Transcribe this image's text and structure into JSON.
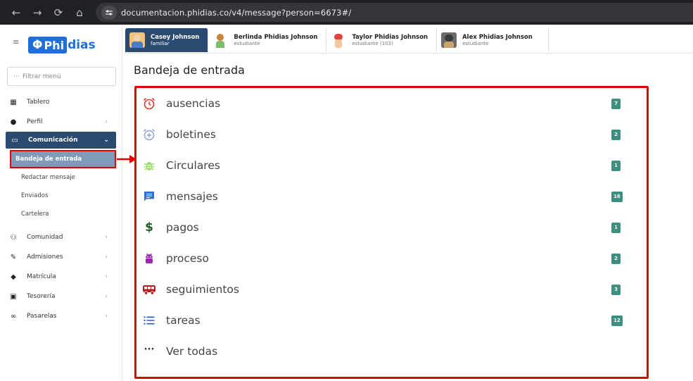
{
  "browser": {
    "url": "documentacion.phidias.co/v4/message?person=6673#/",
    "back": "←",
    "forward": "→",
    "reload": "⟳",
    "home": "⌂"
  },
  "sidebar": {
    "logo_phi": "Φ",
    "logo_text_a": "Phi",
    "logo_text_b": "dias",
    "filter_placeholder": "Filtrar menú",
    "items": [
      {
        "label": "Tablero",
        "icon": "dashboard-icon"
      },
      {
        "label": "Perfil",
        "icon": "person-icon"
      },
      {
        "label": "Comunicación",
        "icon": "message-icon"
      },
      {
        "label": "Comunidad",
        "icon": "group-icon"
      },
      {
        "label": "Admisiones",
        "icon": "admissions-icon"
      },
      {
        "label": "Matrícula",
        "icon": "graduation-cap-icon"
      },
      {
        "label": "Tesorería",
        "icon": "money-icon"
      },
      {
        "label": "Pasarelas",
        "icon": "link-icon"
      }
    ],
    "submenu": [
      {
        "label": "Bandeja de entrada"
      },
      {
        "label": "Redactar mensaje"
      },
      {
        "label": "Enviados"
      },
      {
        "label": "Cartelera"
      }
    ]
  },
  "profiles": [
    {
      "name": "Casey Johnson",
      "role": "familiar"
    },
    {
      "name": "Berlinda Phidias Johnson",
      "role": "estudiante"
    },
    {
      "name": "Taylor Phidias Johnson",
      "role": "estudiante (103)"
    },
    {
      "name": "Alex Phidias Johnson",
      "role": "estudiante"
    }
  ],
  "page": {
    "title": "Bandeja de entrada"
  },
  "inbox": {
    "rows": [
      {
        "label": "ausencias",
        "count": "7",
        "icon": "alarm-clock-icon",
        "color": "#e0392b"
      },
      {
        "label": "boletines",
        "count": "2",
        "icon": "alarm-add-icon",
        "color": "#8fa0d9"
      },
      {
        "label": "Circulares",
        "count": "1",
        "icon": "bug-icon",
        "color": "#9ddc6e"
      },
      {
        "label": "mensajes",
        "count": "16",
        "icon": "chat-icon",
        "color": "#2f6fd6"
      },
      {
        "label": "pagos",
        "count": "1",
        "icon": "dollar-icon",
        "color": "#1a5e20"
      },
      {
        "label": "proceso",
        "count": "2",
        "icon": "android-icon",
        "color": "#9c27b0"
      },
      {
        "label": "seguimientos",
        "count": "3",
        "icon": "bus-icon",
        "color": "#b71c1c"
      },
      {
        "label": "tareas",
        "count": "12",
        "icon": "list-icon",
        "color": "#1e5fc4"
      },
      {
        "label": "Ver todas",
        "count": "",
        "icon": "more-dots-icon",
        "color": "#333333"
      }
    ]
  },
  "colors": {
    "highlight": "#e00000",
    "badge": "#3d8f7f",
    "active_nav": "#2b4a6f"
  }
}
